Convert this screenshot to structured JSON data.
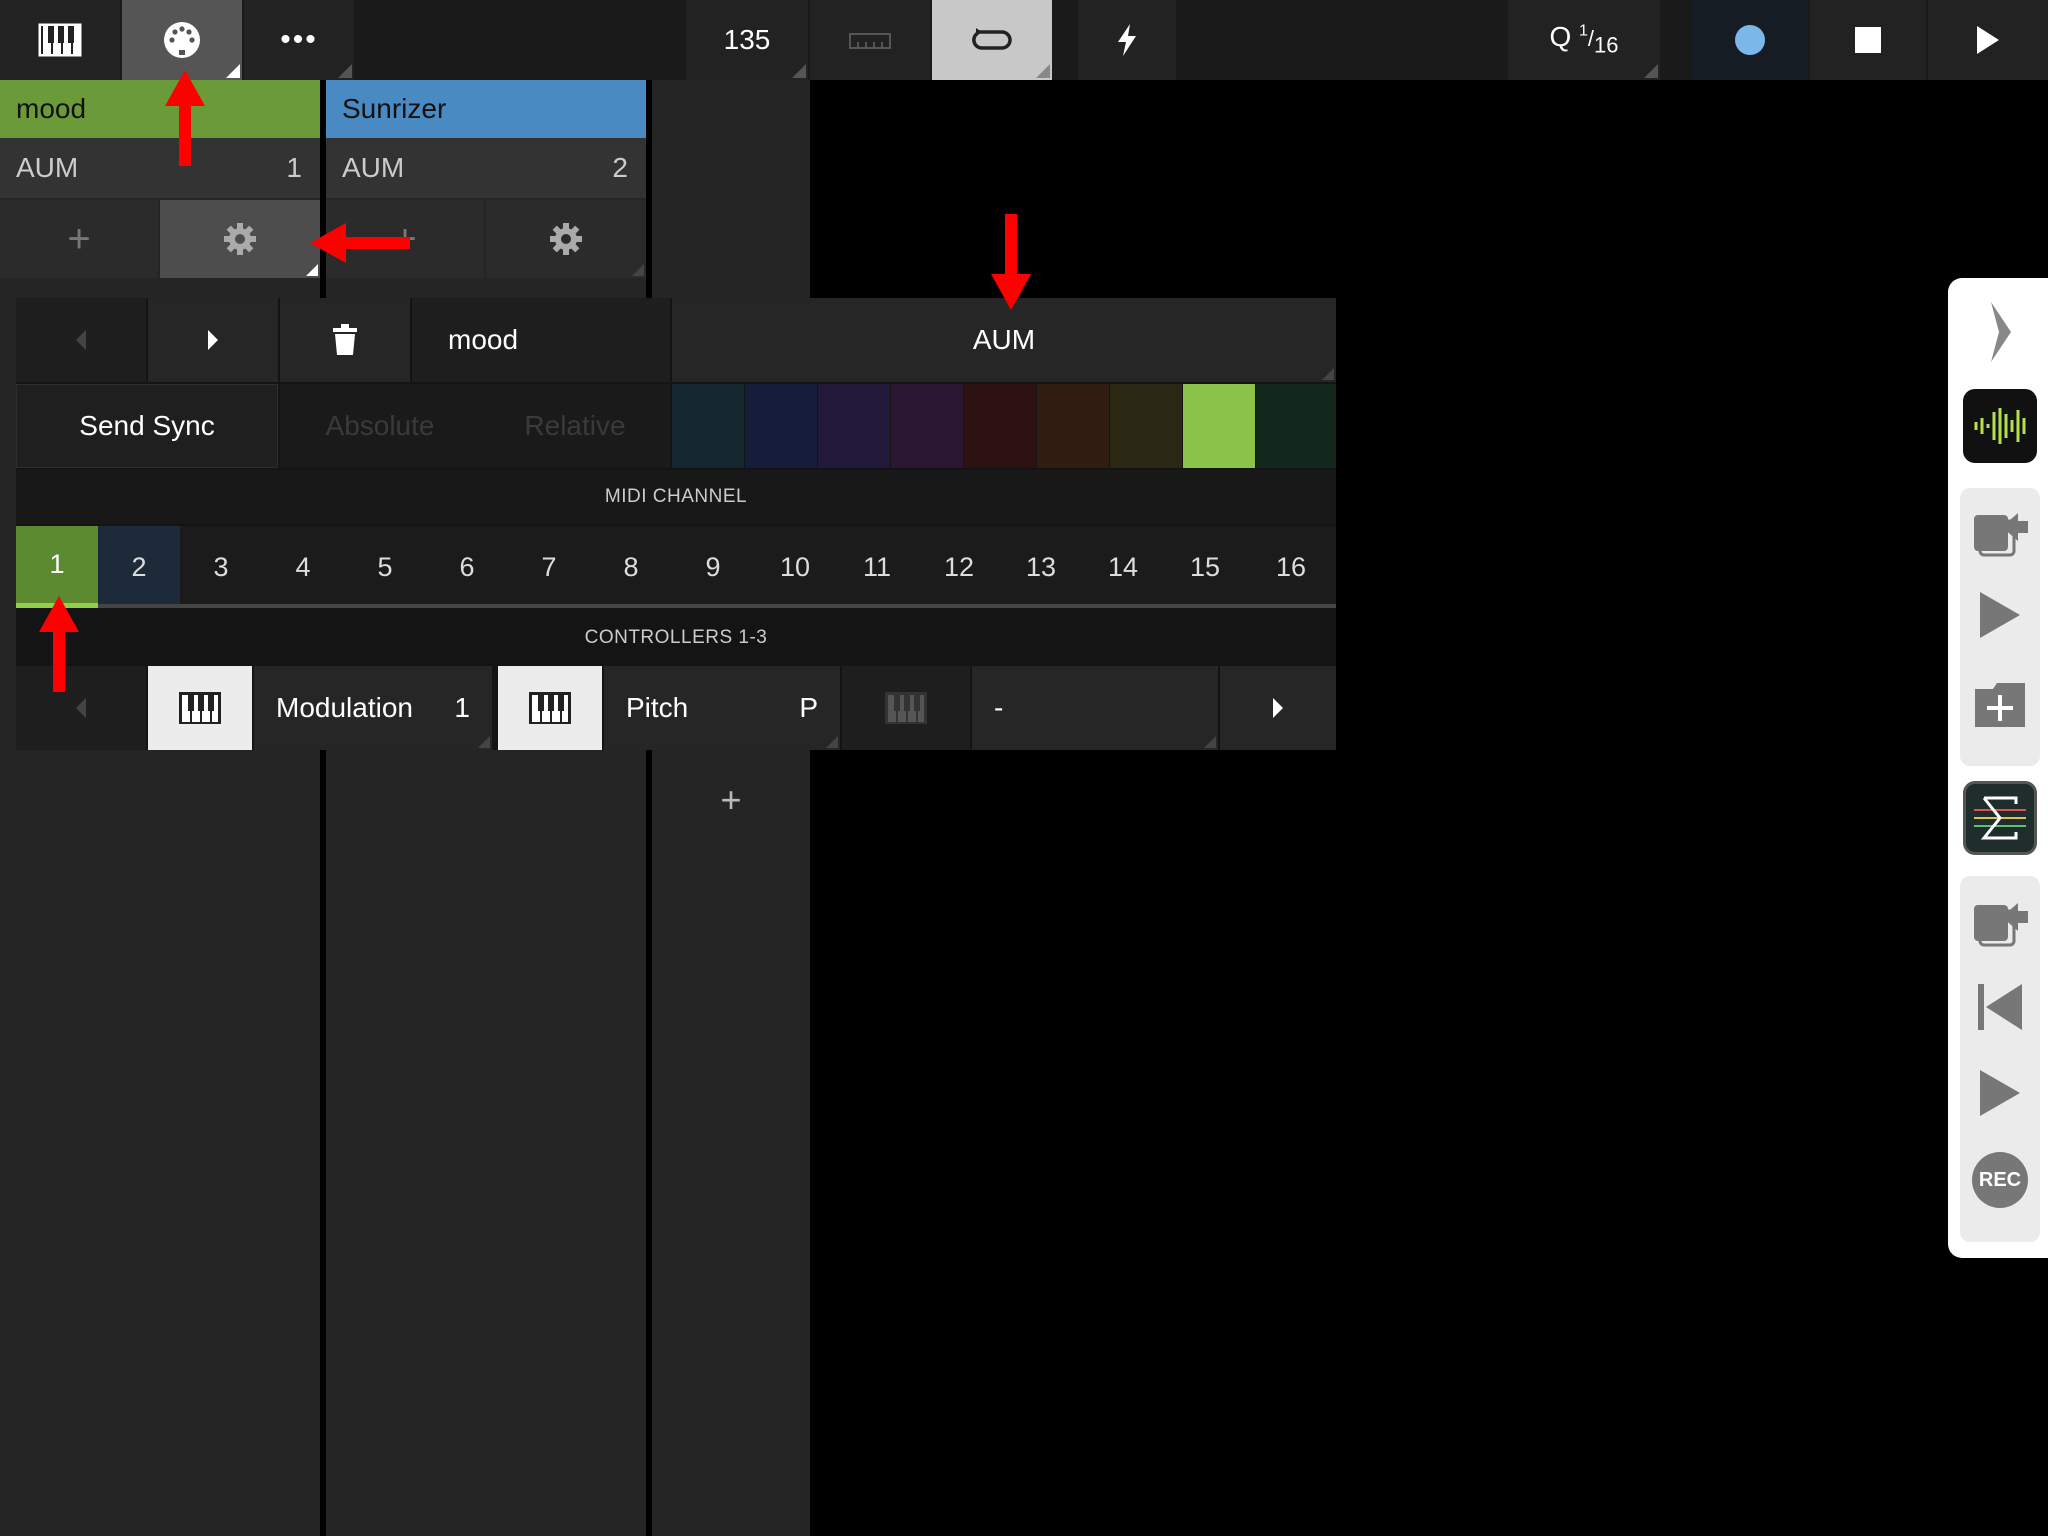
{
  "topbar": {
    "tempo": "135",
    "quantize_q": "Q",
    "quantize_num": "1",
    "quantize_den": "16"
  },
  "tracks": [
    {
      "name": "mood",
      "host": "AUM",
      "number": "1",
      "color": "#6a9b38"
    },
    {
      "name": "Sunrizer",
      "host": "AUM",
      "number": "2",
      "color": "#4a8ac2"
    }
  ],
  "panel": {
    "name": "mood",
    "destination": "AUM",
    "send_sync": "Send Sync",
    "absolute": "Absolute",
    "relative": "Relative",
    "midi_channel_label": "MIDI CHANNEL",
    "channels": [
      "1",
      "2",
      "3",
      "4",
      "5",
      "6",
      "7",
      "8",
      "9",
      "10",
      "11",
      "12",
      "13",
      "14",
      "15",
      "16"
    ],
    "selected_channel": "1",
    "controllers_label": "CONTROLLERS 1-3",
    "controllers": [
      {
        "name": "Modulation",
        "value": "1"
      },
      {
        "name": "Pitch",
        "value": "P"
      },
      {
        "name": "-",
        "value": ""
      }
    ],
    "swatch_colors": [
      "#14262e",
      "#161d3a",
      "#21183a",
      "#2a1632",
      "#2e1212",
      "#2e1d10",
      "#2a2812",
      "#8bc34a",
      "#13281c"
    ]
  },
  "dock": {
    "rec_label": "REC"
  },
  "colors": {
    "accent_green": "#8bc34a",
    "record_blue": "#7ab8ea",
    "annotation_red": "#ff0000"
  }
}
